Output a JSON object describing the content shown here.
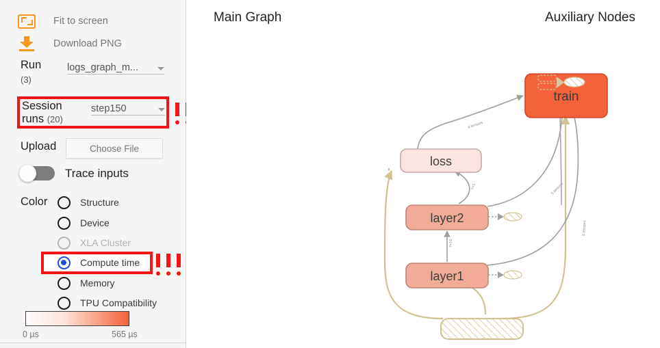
{
  "sidebar": {
    "fit_to_screen": {
      "label": "Fit to screen",
      "icon": "fit-to-screen-icon"
    },
    "download_png": {
      "label": "Download PNG",
      "icon": "download-icon"
    },
    "run": {
      "label": "Run",
      "count": "(3)",
      "value": "logs_graph_m...",
      "caret": "chevron-down-icon"
    },
    "session_runs": {
      "label_line1": "Session",
      "label_line2": "runs",
      "count": "(20)",
      "value": "step150",
      "highlighted": true,
      "annotation": "!!!"
    },
    "upload": {
      "label": "Upload",
      "button_label": "Choose File"
    },
    "trace_inputs": {
      "label": "Trace inputs",
      "enabled": false
    },
    "color": {
      "label": "Color",
      "options": [
        {
          "label": "Structure",
          "state": "unselected"
        },
        {
          "label": "Device",
          "state": "unselected"
        },
        {
          "label": "XLA Cluster",
          "state": "disabled"
        },
        {
          "label": "Compute time",
          "state": "selected",
          "highlighted": true,
          "annotation": "!!!"
        },
        {
          "label": "Memory",
          "state": "unselected"
        },
        {
          "label": "TPU Compatibility",
          "state": "unselected"
        }
      ]
    },
    "legend": {
      "min": "0 µs",
      "max": "565 µs",
      "gradient_start": "#fffdfc",
      "gradient_end": "#f4623a"
    }
  },
  "canvas": {
    "main_graph_title": "Main Graph",
    "auxiliary_nodes_title": "Auxiliary Nodes",
    "nodes": [
      {
        "id": "train",
        "label": "train",
        "fill": "#f4623a",
        "stroke": "#d0472a"
      },
      {
        "id": "loss",
        "label": "loss",
        "fill": "#fbe5e0",
        "stroke": "#c4a9a5"
      },
      {
        "id": "layer2",
        "label": "layer2",
        "fill": "#f2ab99",
        "stroke": "#c0867a"
      },
      {
        "id": "layer1",
        "label": "layer1",
        "fill": "#f2ab99",
        "stroke": "#c0867a"
      },
      {
        "id": "input",
        "label": "",
        "fill": "hatched",
        "stroke": "#d2c193"
      }
    ],
    "edge_labels": [
      "4 tensors",
      "5 tensors",
      "6 tensors",
      "?×1",
      "?×10"
    ],
    "aux_nodes": {
      "count": 3,
      "style": "dashed-rects-to-hatched-ellipse"
    },
    "accent_colors": {
      "orange": "#f5961e",
      "red_annotation": "#f41616",
      "edge_gray": "#9e9e9e",
      "edge_tan": "#d2c193"
    }
  }
}
